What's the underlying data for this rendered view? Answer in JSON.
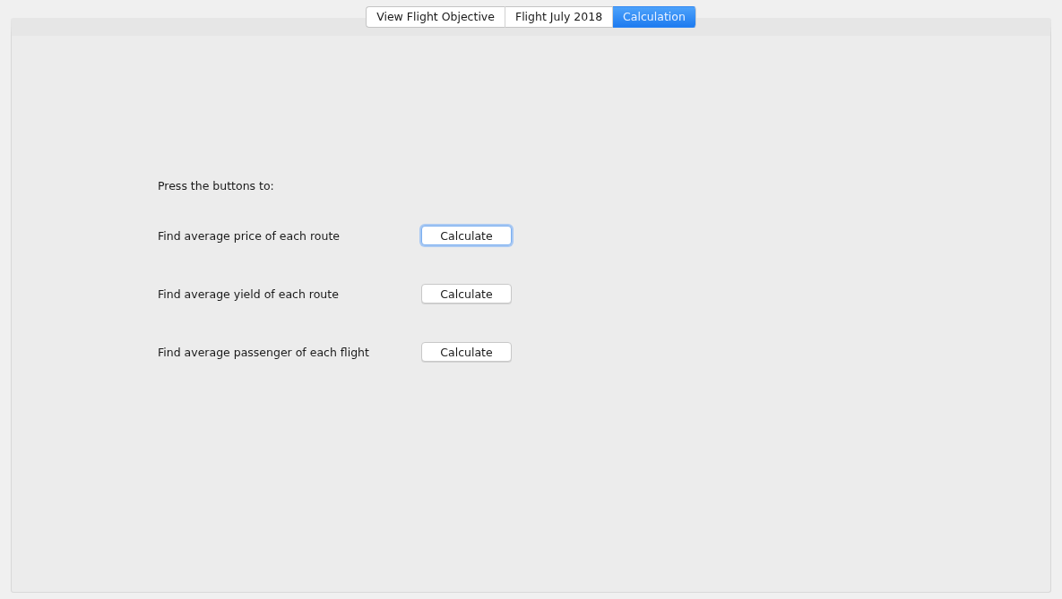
{
  "tabs": [
    {
      "label": "View Flight Objective",
      "selected": false
    },
    {
      "label": "Flight July 2018",
      "selected": false
    },
    {
      "label": "Calculation",
      "selected": true
    }
  ],
  "intro": "Press the buttons to:",
  "actions": [
    {
      "label": "Find average price of each route",
      "button": "Calculate",
      "focused": true
    },
    {
      "label": "Find average yield of each route",
      "button": "Calculate",
      "focused": false
    },
    {
      "label": "Find average passenger of each flight",
      "button": "Calculate",
      "focused": false
    }
  ]
}
